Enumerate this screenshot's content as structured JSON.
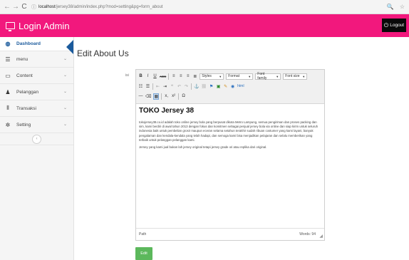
{
  "browser": {
    "back": "←",
    "forward": "→",
    "reload": "C",
    "info_icon": "ⓘ",
    "url_host": "localhost",
    "url_path": "/jersey38/admin/index.php?mod=setting&pg=form_about",
    "zoom_icon": "🔍",
    "star_icon": "☆"
  },
  "header": {
    "title": "Login Admin",
    "logout_label": "Logout",
    "colors": {
      "accent": "#f2187d",
      "logout_bg": "#0a0a0a"
    }
  },
  "sidebar": {
    "items": [
      {
        "label": "Dashboard",
        "icon": "dashboard-icon",
        "glyph": "◍",
        "active": true
      },
      {
        "label": "menu",
        "icon": "list-icon",
        "glyph": "☰",
        "active": false
      },
      {
        "label": "Content",
        "icon": "monitor-icon",
        "glyph": "▭",
        "active": false
      },
      {
        "label": "Pelanggan",
        "icon": "user-icon",
        "glyph": "♟",
        "active": false
      },
      {
        "label": "Transaksi",
        "icon": "barcode-icon",
        "glyph": "⦀",
        "active": false
      },
      {
        "label": "Setting",
        "icon": "gear-icon",
        "glyph": "✲",
        "active": false
      }
    ],
    "chevron": "⌄",
    "collapse": "‹"
  },
  "main": {
    "page_title": "Edit About Us",
    "field_label": "isi",
    "edit_button": "Edit"
  },
  "editor": {
    "toolbar": {
      "row1": {
        "bold": "B",
        "italic": "I",
        "underline": "U",
        "strike": "ABC",
        "styles": "Styles",
        "format": "Format",
        "font_family": "Font family",
        "font_size": "Font size"
      },
      "row2": {
        "link": "⚓",
        "unlink": "⛓",
        "anchor": "⚑",
        "image": "▣",
        "cleanup": "✎",
        "code": "◉"
      },
      "row3": {
        "hr": "—",
        "subscript": "x,",
        "superscript": "x²",
        "charmap": "Ω"
      }
    },
    "heading": "TOKO Jersey 38",
    "paragraphs": [
      "tokojersey38.co.id adalah toko online jersey bola yang berpusat dikota Metro Lampung, semua pengiriman dan proses packing dan sim, kami berdiri di awal tahun 2013 dengan fokus dan komitmen sebagai penjual jersey bola via online dan siap kirim untuk seluruh indonesia baik untuk pembelian grosir maupun eceran selama setahun terakhir sudah ribuan costumer yang kami layani, banyak pengalaman dan kendala-kendala yang telah hadapi, dan semoga kami bisa menjadikan pelajaran dan selalu memberikan yang terbaik untuk pelanggan pelanggan kami.",
      "Jersey yang kami jual bukan lah jersey original tetapi jersey grade ori atau replika dari original."
    ],
    "status_path": "Path",
    "status_words": "Words: 94"
  }
}
